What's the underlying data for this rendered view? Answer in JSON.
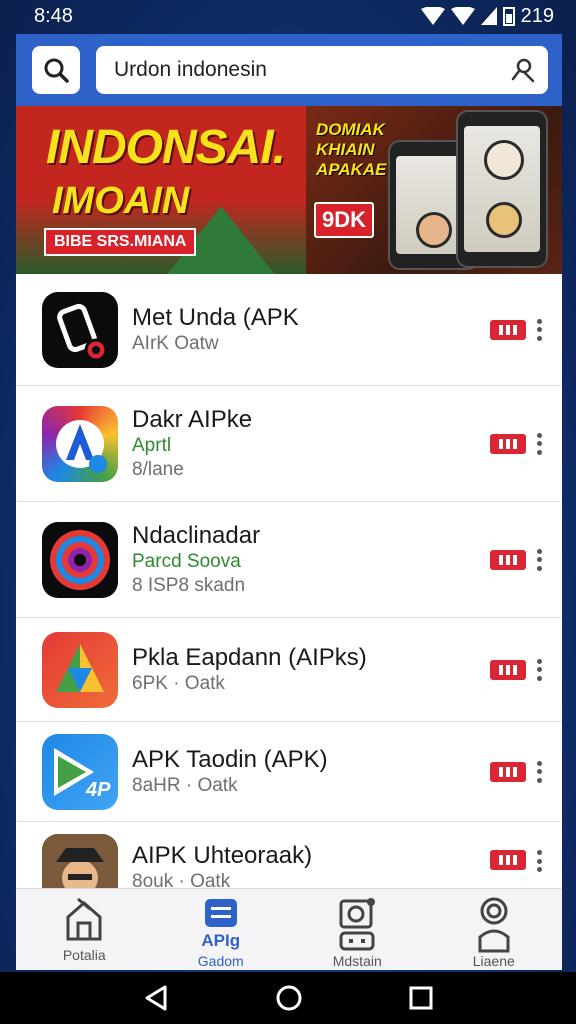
{
  "status_bar": {
    "time": "8:48",
    "battery": "219"
  },
  "search": {
    "value": "Urdon indonesin"
  },
  "banner": {
    "title": "INDONSAI.",
    "subtitle": "IMOAIN",
    "ribbon": "BIBE SRS.MIANA",
    "promo_lines": [
      "DOMIAK",
      "KHIAIN",
      "APAKAE"
    ],
    "badge": "9DK"
  },
  "apps": [
    {
      "name": "Met Unda (APK",
      "tag": "",
      "meta": "AIrK Oatw",
      "icon": "phone-camera-icon"
    },
    {
      "name": "Dakr AIPke",
      "tag": "Aprtl",
      "meta": "8/lane",
      "icon": "colorful-a-logo-icon"
    },
    {
      "name": "Ndaclinadar",
      "tag": "Parcd Soova",
      "meta": "8 ISP8 skadn",
      "icon": "spiral-disc-icon"
    },
    {
      "name": "Pkla Eapdann (AIPks)",
      "tag": "",
      "meta": "6PK · Oatk",
      "icon": "triangle-logo-icon"
    },
    {
      "name": "APK Taodin (APK)",
      "tag": "",
      "meta": "8aHR · Oatk",
      "icon": "play-store-icon"
    },
    {
      "name": "AIPK Uhteoraak)",
      "tag": "",
      "meta": "8ouk · Oatk",
      "icon": "avatar-photo-icon"
    }
  ],
  "bottom_nav": [
    {
      "label": "Potalia",
      "icon": "home-icon"
    },
    {
      "label": "Gadom",
      "center": "APIg",
      "icon": "apps-icon",
      "active": true
    },
    {
      "label": "Mdstain",
      "icon": "games-icon"
    },
    {
      "label": "Liaene",
      "icon": "profile-icon"
    }
  ],
  "colors": {
    "primary": "#2f62c9",
    "download": "#d92534",
    "tag_green": "#2e8b2e"
  }
}
